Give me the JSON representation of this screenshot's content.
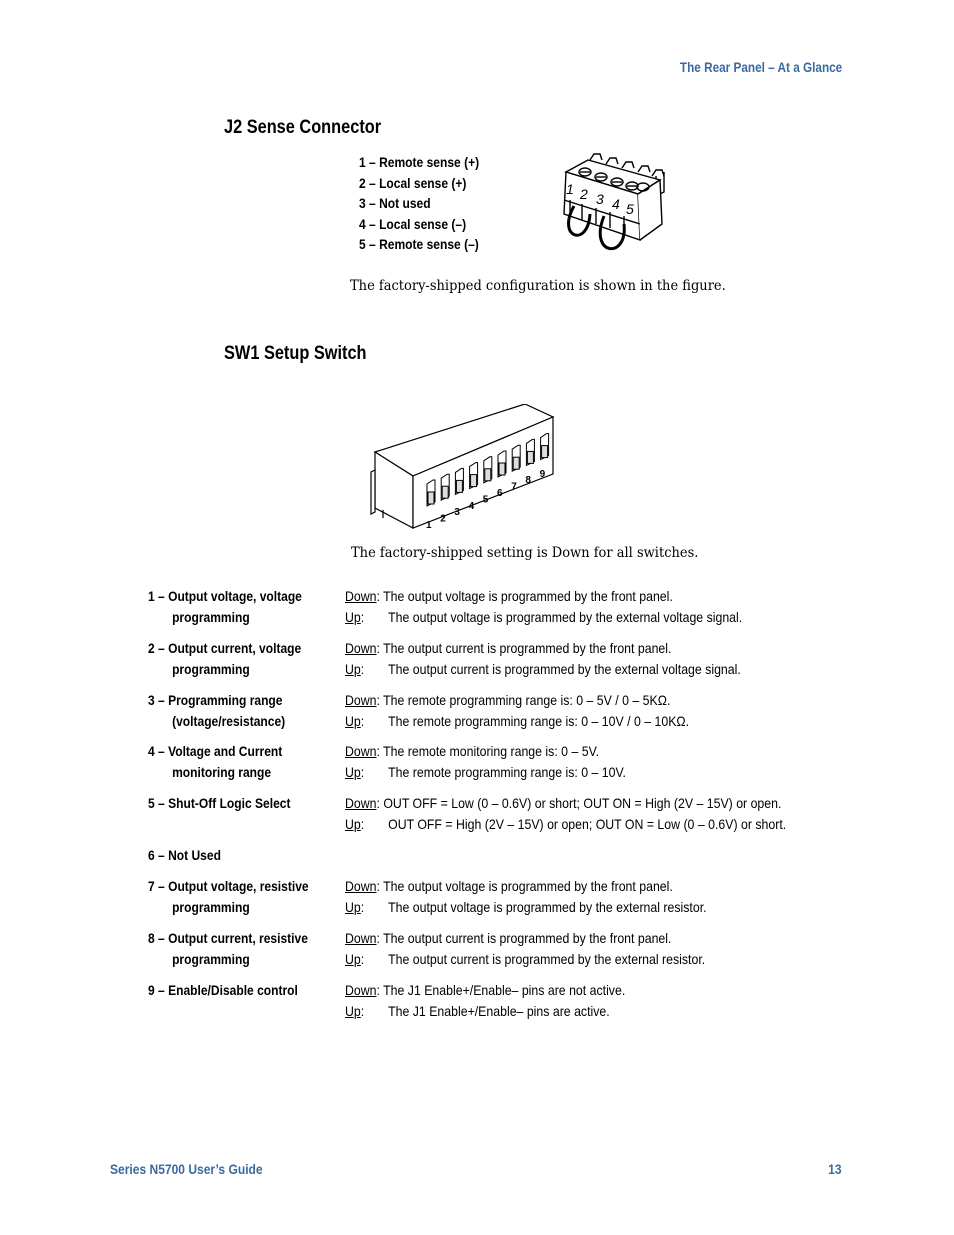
{
  "header": {
    "section_title": "The Rear Panel – At a Glance"
  },
  "j2": {
    "heading": "J2 Sense Connector",
    "pins": [
      "1 – Remote sense (+)",
      "2 – Local sense (+)",
      "3 – Not used",
      "4 – Local sense (–)",
      "5 – Remote sense (–)"
    ],
    "figure_pin_numbers": [
      "1",
      "2",
      "3",
      "4",
      "5"
    ],
    "caption": "The factory-shipped configuration is shown in the figure."
  },
  "sw1": {
    "heading": "SW1 Setup Switch",
    "figure_switch_numbers": [
      "1",
      "2",
      "3",
      "4",
      "5",
      "6",
      "7",
      "8",
      "9"
    ],
    "caption": "The factory-shipped setting is Down for all switches.",
    "down_key": "Down",
    "up_key": "Up",
    "switches": [
      {
        "label_line1": "1 – Output voltage, voltage",
        "label_line2": "programming",
        "down": "The output voltage is programmed by the front panel.",
        "up": "The output voltage is programmed by the external voltage signal."
      },
      {
        "label_line1": "2 – Output current, voltage",
        "label_line2": "programming",
        "down": "The output current is programmed by the front panel.",
        "up": "The output current is programmed by the external voltage signal."
      },
      {
        "label_line1": "3 – Programming range",
        "label_line2": "(voltage/resistance)",
        "down": "The remote programming range is: 0 – 5V / 0 – 5KΩ.",
        "up": "The remote programming range is: 0 – 10V / 0 – 10KΩ."
      },
      {
        "label_line1": "4 – Voltage and Current",
        "label_line2": "monitoring range",
        "down": "The remote monitoring range is: 0 – 5V.",
        "up": "The remote programming range is: 0 – 10V."
      },
      {
        "label_line1": "5 – Shut-Off Logic Select",
        "label_line2": "",
        "down": "OUT OFF = Low (0 – 0.6V) or short;  OUT ON = High (2V – 15V) or open.",
        "up": "OUT OFF = High (2V – 15V) or open;  OUT ON = Low (0 – 0.6V) or short."
      },
      {
        "label_line1": "6 – Not Used",
        "label_line2": "",
        "down": "",
        "up": ""
      },
      {
        "label_line1": "7 – Output voltage, resistive",
        "label_line2": "programming",
        "down": "The output voltage is programmed by the front panel.",
        "up": "The output voltage is programmed by the external resistor."
      },
      {
        "label_line1": "8 – Output current, resistive",
        "label_line2": "programming",
        "down": "The output current is programmed by the front panel.",
        "up": "The output current is programmed by the external resistor."
      },
      {
        "label_line1": "9 – Enable/Disable control",
        "label_line2": "",
        "down": "The J1 Enable+/Enable– pins are not active.",
        "up": "The J1 Enable+/Enable– pins are active."
      }
    ]
  },
  "footer": {
    "guide_title": "Series N5700 User’s Guide",
    "page_number": "13"
  }
}
